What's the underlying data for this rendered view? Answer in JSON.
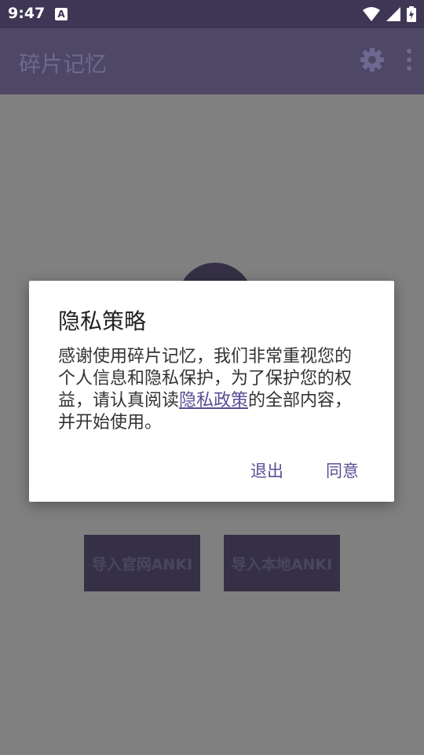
{
  "status_bar": {
    "time": "9:47",
    "app_icon_letter": "A"
  },
  "app_bar": {
    "title": "碎片记忆",
    "icons": [
      "gear-icon",
      "more-vert-icon"
    ]
  },
  "content": {
    "buttons": [
      "导入官网ANKI",
      "导入本地ANKI"
    ]
  },
  "dialog": {
    "title": "隐私策略",
    "message_part1": "感谢使用碎片记忆，我们非常重视您的个人信息和隐私保护，为了保护您的权益，请认真阅读",
    "link_text": "隐私政策",
    "message_part2": "的全部内容，并开始使用。",
    "exit_label": "退出",
    "agree_label": "同意"
  },
  "colors": {
    "accent": "#5b4e95",
    "app_bar": "#4e4766",
    "status_bar": "#3e3654",
    "scrim": "rgba(0,0,0,0.32)"
  }
}
